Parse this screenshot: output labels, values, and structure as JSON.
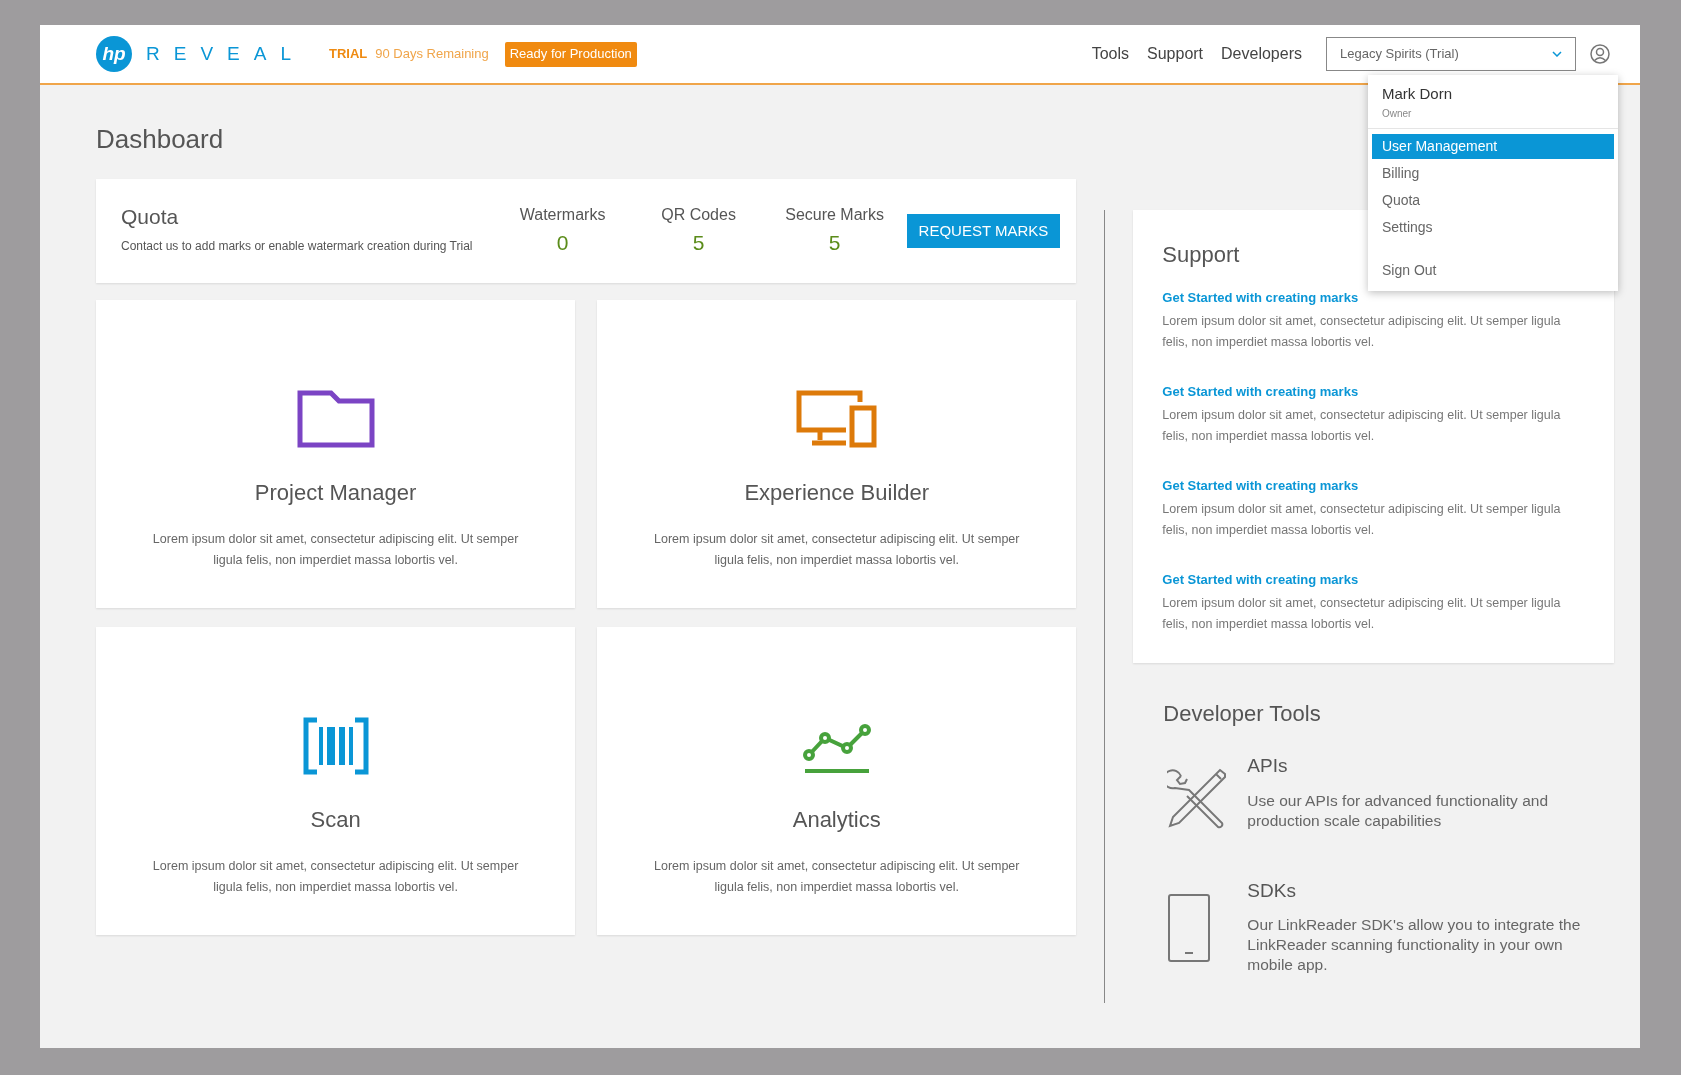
{
  "header": {
    "logo_mark": "hp",
    "logo_name": "REVEAL",
    "trial_label": "TRIAL",
    "trial_remaining": "90 Days Remaining",
    "production_button": "Ready for Production",
    "nav": [
      "Tools",
      "Support",
      "Developers"
    ],
    "account_select": {
      "value": "Legacy Spirits (Trial)"
    }
  },
  "user_menu": {
    "name": "Mark Dorn",
    "role": "Owner",
    "items": [
      {
        "label": "User Management",
        "selected": true
      },
      {
        "label": "Billing",
        "selected": false
      },
      {
        "label": "Quota",
        "selected": false
      },
      {
        "label": "Settings",
        "selected": false
      }
    ],
    "sign_out": "Sign Out"
  },
  "page_title": "Dashboard",
  "quota": {
    "title": "Quota",
    "description": "Contact us to add marks or enable watermark creation during Trial",
    "stats": [
      {
        "label": "Watermarks",
        "value": "0"
      },
      {
        "label": "QR Codes",
        "value": "5"
      },
      {
        "label": "Secure Marks",
        "value": "5"
      }
    ],
    "button": "REQUEST MARKS"
  },
  "cards": [
    {
      "kind": "folder",
      "title": "Project Manager",
      "text": "Lorem ipsum dolor sit amet, consectetur adipiscing elit. Ut semper ligula felis, non imperdiet massa lobortis vel."
    },
    {
      "kind": "devices",
      "title": "Experience Builder",
      "text": "Lorem ipsum dolor sit amet, consectetur adipiscing elit. Ut semper ligula felis, non imperdiet massa lobortis vel."
    },
    {
      "kind": "barcode",
      "title": "Scan",
      "text": "Lorem ipsum dolor sit amet, consectetur adipiscing elit. Ut semper ligula felis, non imperdiet massa lobortis vel."
    },
    {
      "kind": "chart",
      "title": "Analytics",
      "text": "Lorem ipsum dolor sit amet, consectetur adipiscing elit. Ut semper ligula felis, non imperdiet massa lobortis vel."
    }
  ],
  "support": {
    "title": "Support",
    "articles": [
      {
        "link": "Get Started with creating marks",
        "text": "Lorem ipsum dolor sit amet, consectetur adipiscing elit. Ut semper ligula felis, non imperdiet massa lobortis vel."
      },
      {
        "link": "Get Started with creating marks",
        "text": "Lorem ipsum dolor sit amet, consectetur adipiscing elit. Ut semper ligula felis, non imperdiet massa lobortis vel."
      },
      {
        "link": "Get Started with creating marks",
        "text": "Lorem ipsum dolor sit amet, consectetur adipiscing elit. Ut semper ligula felis, non imperdiet massa lobortis vel."
      },
      {
        "link": "Get Started with creating marks",
        "text": "Lorem ipsum dolor sit amet, consectetur adipiscing elit. Ut semper ligula felis, non imperdiet massa lobortis vel."
      }
    ]
  },
  "developer_tools": {
    "title": "Developer Tools",
    "items": [
      {
        "kind": "api",
        "title": "APIs",
        "text": "Use our APIs for advanced functionality and production scale capabilities"
      },
      {
        "kind": "sdk",
        "title": "SDKs",
        "text": "Our LinkReader SDK's allow you to integrate the LinkReader scanning functionality in your own mobile app."
      }
    ]
  }
}
